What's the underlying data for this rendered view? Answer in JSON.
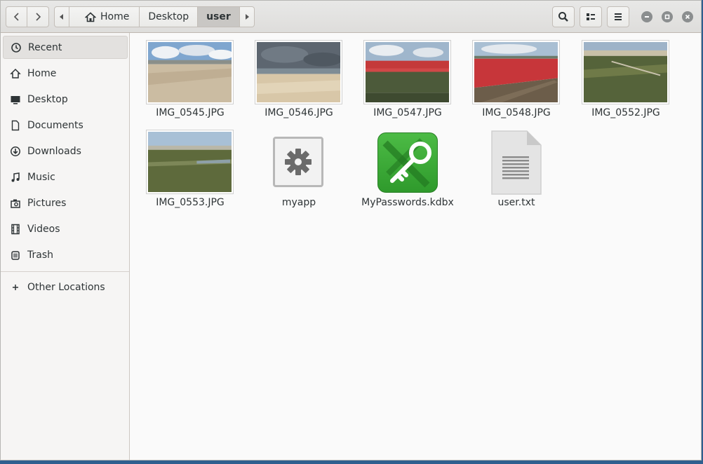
{
  "header": {
    "back_icon": "chevron-left-icon",
    "forward_icon": "chevron-right-icon",
    "path": [
      "Home",
      "Desktop",
      "user"
    ],
    "search_icon": "search-icon",
    "view_toggle_icon": "list-view-icon",
    "menu_icon": "hamburger-menu-icon",
    "window_controls": [
      "minimize",
      "maximize",
      "close"
    ]
  },
  "sidebar": {
    "items": [
      {
        "label": "Recent",
        "icon": "clock-icon"
      },
      {
        "label": "Home",
        "icon": "home-icon"
      },
      {
        "label": "Desktop",
        "icon": "desktop-icon"
      },
      {
        "label": "Documents",
        "icon": "document-icon"
      },
      {
        "label": "Downloads",
        "icon": "download-icon"
      },
      {
        "label": "Music",
        "icon": "music-icon"
      },
      {
        "label": "Pictures",
        "icon": "camera-icon"
      },
      {
        "label": "Videos",
        "icon": "film-icon"
      },
      {
        "label": "Trash",
        "icon": "trash-icon"
      }
    ],
    "other": {
      "label": "Other Locations",
      "icon": "plus-icon"
    }
  },
  "files": [
    {
      "name": "IMG_0545.JPG",
      "kind": "image"
    },
    {
      "name": "IMG_0546.JPG",
      "kind": "image"
    },
    {
      "name": "IMG_0547.JPG",
      "kind": "image"
    },
    {
      "name": "IMG_0548.JPG",
      "kind": "image"
    },
    {
      "name": "IMG_0552.JPG",
      "kind": "image"
    },
    {
      "name": "IMG_0553.JPG",
      "kind": "image"
    },
    {
      "name": "myapp",
      "kind": "executable"
    },
    {
      "name": "MyPasswords.kdbx",
      "kind": "keepass"
    },
    {
      "name": "user.txt",
      "kind": "text"
    }
  ],
  "colors": {
    "accent_green": "#3aa23a",
    "sidebar_bg": "#f6f5f4",
    "content_bg": "#fafafa"
  }
}
